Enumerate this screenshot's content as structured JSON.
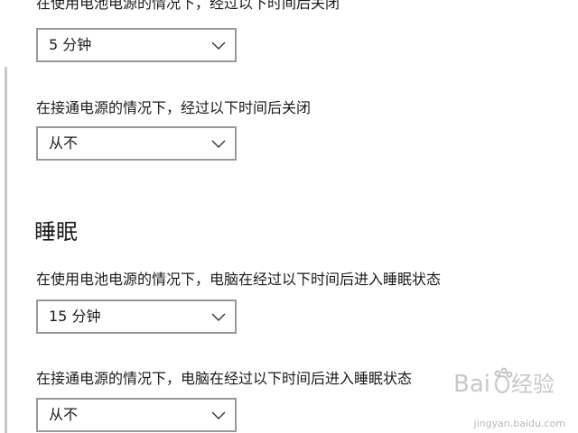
{
  "screen_off": {
    "battery_label": "在使用电池电源的情况下，经过以下时间后关闭",
    "battery_value": "5 分钟",
    "plugged_label": "在接通电源的情况下，经过以下时间后关闭",
    "plugged_value": "从不"
  },
  "sleep": {
    "title": "睡眠",
    "battery_label": "在使用电池电源的情况下，电脑在经过以下时间后进入睡眠状态",
    "battery_value": "15 分钟",
    "plugged_label": "在接通电源的情况下，电脑在经过以下时间后进入睡眠状态",
    "plugged_value": "从不"
  },
  "watermark": {
    "brand": "Baidu经验",
    "url": "jingyan.baidu.com"
  },
  "icons": {
    "dropdown": "chevron-down-icon"
  },
  "colors": {
    "text": "#1a1a1a",
    "dropdown_border": "#999999",
    "background": "#ffffff"
  }
}
